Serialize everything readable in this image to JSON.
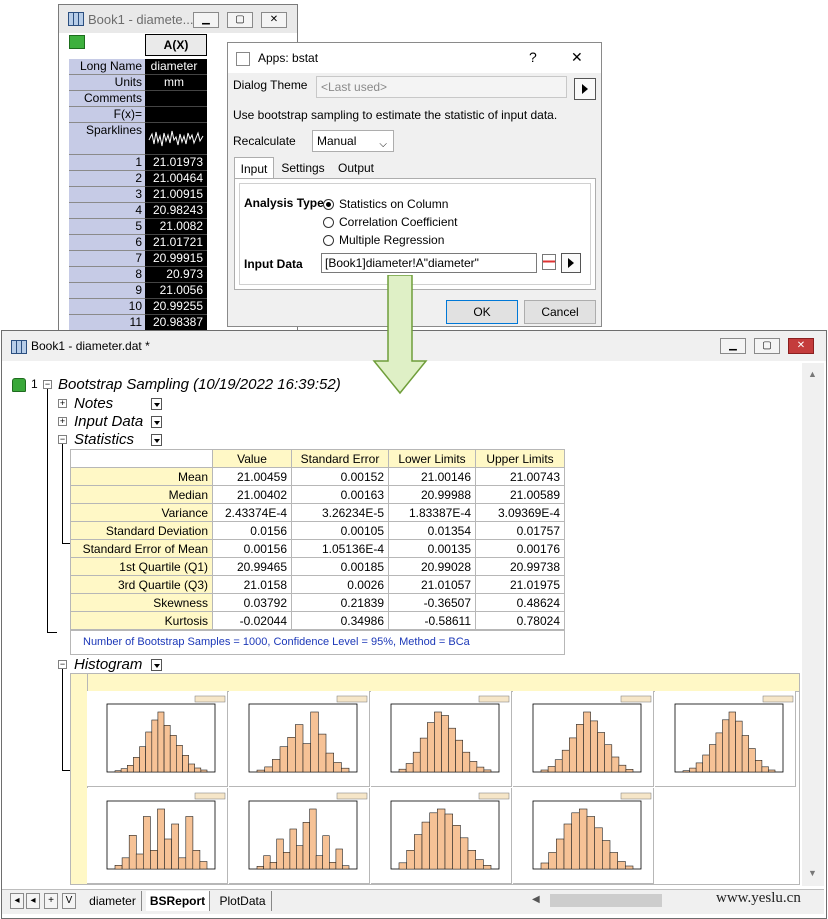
{
  "worksheet": {
    "title": "Book1 - diamete...",
    "column_header": "A(X)",
    "labels": [
      "Long Name",
      "Units",
      "Comments",
      "F(x)=",
      "Sparklines"
    ],
    "long_name": "diameter",
    "units": "mm",
    "rows": [
      {
        "n": "1",
        "v": "21.01973"
      },
      {
        "n": "2",
        "v": "21.00464"
      },
      {
        "n": "3",
        "v": "21.00915"
      },
      {
        "n": "4",
        "v": "20.98243"
      },
      {
        "n": "5",
        "v": "21.0082"
      },
      {
        "n": "6",
        "v": "21.01721"
      },
      {
        "n": "7",
        "v": "20.99915"
      },
      {
        "n": "8",
        "v": "20.973"
      },
      {
        "n": "9",
        "v": "21.0056"
      },
      {
        "n": "10",
        "v": "20.99255"
      },
      {
        "n": "11",
        "v": "20.98387"
      }
    ]
  },
  "dialog": {
    "title": "Apps: bstat",
    "help": "?",
    "close": "✕",
    "theme_label": "Dialog Theme",
    "theme_value": "<Last used>",
    "description": "Use bootstrap sampling to estimate the statistic of input data.",
    "recalc_label": "Recalculate",
    "recalc_value": "Manual",
    "tabs": [
      "Input",
      "Settings",
      "Output"
    ],
    "analysis_type_label": "Analysis Type",
    "options": [
      "Statistics on Column",
      "Correlation Coefficient",
      "Multiple Regression"
    ],
    "input_data_label": "Input Data",
    "input_data_value": "[Book1]diameter!A\"diameter\"",
    "ok": "OK",
    "cancel": "Cancel"
  },
  "report": {
    "title": "Book1 - diameter.dat *",
    "node_number": "1",
    "heading": "Bootstrap Sampling (10/19/2022 16:39:52)",
    "sections": [
      "Notes",
      "Input Data",
      "Statistics",
      "Histogram"
    ],
    "stats": {
      "columns": [
        "Value",
        "Standard Error",
        "Lower Limits",
        "Upper Limits"
      ],
      "rows": [
        {
          "name": "Mean",
          "cells": [
            "21.00459",
            "0.00152",
            "21.00146",
            "21.00743"
          ]
        },
        {
          "name": "Median",
          "cells": [
            "21.00402",
            "0.00163",
            "20.99988",
            "21.00589"
          ]
        },
        {
          "name": "Variance",
          "cells": [
            "2.43374E-4",
            "3.26234E-5",
            "1.83387E-4",
            "3.09369E-4"
          ]
        },
        {
          "name": "Standard Deviation",
          "cells": [
            "0.0156",
            "0.00105",
            "0.01354",
            "0.01757"
          ]
        },
        {
          "name": "Standard Error of Mean",
          "cells": [
            "0.00156",
            "1.05136E-4",
            "0.00135",
            "0.00176"
          ]
        },
        {
          "name": "1st Quartile (Q1)",
          "cells": [
            "20.99465",
            "0.00185",
            "20.99028",
            "20.99738"
          ]
        },
        {
          "name": "3rd Quartile (Q3)",
          "cells": [
            "21.0158",
            "0.0026",
            "21.01057",
            "21.01975"
          ]
        },
        {
          "name": "Skewness",
          "cells": [
            "0.03792",
            "0.21839",
            "-0.36507",
            "0.48624"
          ]
        },
        {
          "name": "Kurtosis",
          "cells": [
            "-0.02044",
            "0.34986",
            "-0.58611",
            "0.78024"
          ]
        }
      ],
      "note": "Number of Bootstrap Samples = 1000, Confidence Level = 95%, Method = BCa"
    },
    "histograms": [
      {
        "bars": [
          2,
          5,
          10,
          22,
          38,
          60,
          78,
          90,
          70,
          55,
          40,
          25,
          12,
          6,
          3
        ]
      },
      {
        "bars": [
          3,
          8,
          20,
          40,
          55,
          75,
          45,
          95,
          60,
          30,
          15,
          6
        ]
      },
      {
        "bars": [
          4,
          12,
          28,
          48,
          70,
          85,
          80,
          62,
          45,
          28,
          15,
          7,
          3
        ]
      },
      {
        "bars": [
          3,
          8,
          18,
          32,
          50,
          70,
          88,
          75,
          58,
          40,
          22,
          10,
          4
        ]
      },
      {
        "bars": [
          2,
          6,
          14,
          26,
          42,
          60,
          80,
          92,
          78,
          56,
          36,
          18,
          8,
          3
        ]
      },
      {
        "bars": [
          5,
          15,
          45,
          20,
          70,
          25,
          80,
          40,
          60,
          15,
          70,
          25,
          10
        ]
      },
      {
        "bars": [
          4,
          20,
          10,
          45,
          25,
          60,
          35,
          70,
          90,
          20,
          50,
          10,
          30,
          5
        ]
      },
      {
        "bars": [
          10,
          30,
          55,
          75,
          90,
          96,
          88,
          70,
          50,
          30,
          15,
          6
        ]
      },
      {
        "bars": [
          8,
          22,
          40,
          60,
          75,
          80,
          70,
          55,
          38,
          22,
          10,
          4
        ]
      }
    ],
    "sheet_tabs": [
      "diameter",
      "BSReport",
      "PlotData"
    ],
    "watermark": "www.yeslu.cn"
  }
}
